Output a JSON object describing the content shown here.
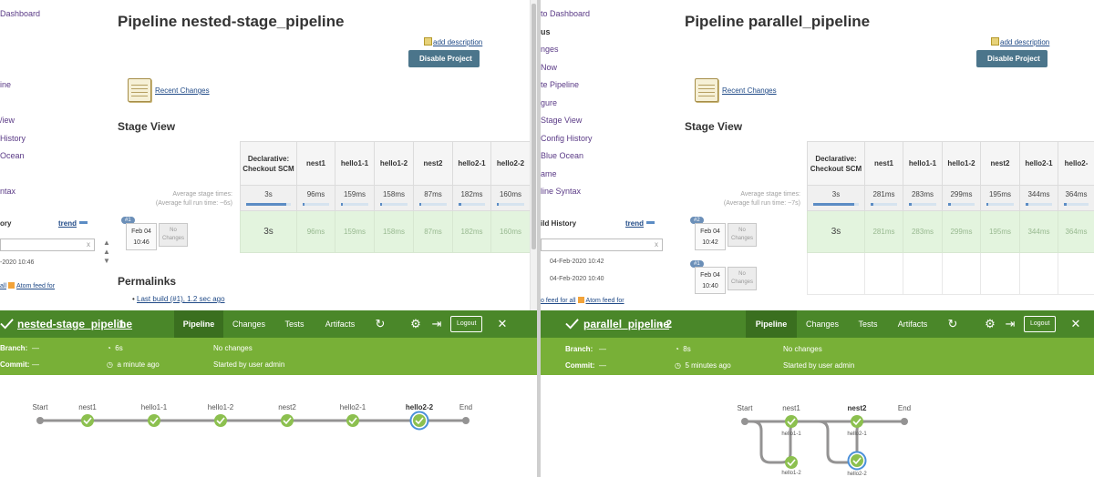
{
  "left": {
    "sidebar": [
      "Dashboard",
      "ine",
      "/iew",
      "History",
      "Ocean",
      "ntax"
    ],
    "title": "Pipeline nested-stage_pipeline",
    "add_description": "add description",
    "disable_button": "Disable Project",
    "recent_changes": "Recent Changes",
    "stage_view_title": "Stage View",
    "avg_label_1": "Average stage times:",
    "avg_label_2": "(Average full run time: ~6s)",
    "stages": [
      "Declarative: Checkout SCM",
      "nest1",
      "hello1-1",
      "hello1-2",
      "nest2",
      "hello2-1",
      "hello2-2"
    ],
    "avg_times": [
      "3s",
      "96ms",
      "159ms",
      "158ms",
      "87ms",
      "182ms",
      "160ms"
    ],
    "avg_fill": [
      0.9,
      0.06,
      0.08,
      0.08,
      0.05,
      0.09,
      0.08
    ],
    "runs": [
      {
        "num": "#1",
        "date": "Feb 04",
        "time": "10:46",
        "changes": "No Changes",
        "cells": [
          "3s",
          "96ms",
          "159ms",
          "158ms",
          "87ms",
          "182ms",
          "160ms"
        ]
      }
    ],
    "build_history_title": "ory",
    "trend": "trend",
    "search_clear": "x",
    "history_items": [
      "-2020 10:46"
    ],
    "feed_all": "all",
    "feed_atom": "Atom feed for",
    "permalinks_title": "Permalinks",
    "permalink_item": "Last build (#1), 1.2 sec ago",
    "blue_ocean": {
      "name": "nested-stage_pipeline",
      "run": "1",
      "tabs": [
        "Pipeline",
        "Changes",
        "Tests",
        "Artifacts"
      ],
      "logout": "Logout",
      "branch_label": "Branch:",
      "branch_value": "—",
      "commit_label": "Commit:",
      "commit_value": "—",
      "duration": "6s",
      "ago": "a minute ago",
      "changes": "No changes",
      "started_by": "Started by user admin",
      "graph_nodes": [
        "Start",
        "nest1",
        "hello1-1",
        "hello1-2",
        "nest2",
        "hello2-1",
        "hello2-2",
        "End"
      ]
    }
  },
  "right": {
    "sidebar": [
      "to Dashboard",
      "us",
      "nges",
      "Now",
      "te Pipeline",
      "gure",
      "Stage View",
      "Config History",
      "Blue Ocean",
      "ame",
      "line Syntax"
    ],
    "title": "Pipeline parallel_pipeline",
    "add_description": "add description",
    "disable_button": "Disable Project",
    "recent_changes": "Recent Changes",
    "stage_view_title": "Stage View",
    "avg_label_1": "Average stage times:",
    "avg_label_2": "(Average full run time: ~7s)",
    "stages": [
      "Declarative: Checkout SCM",
      "nest1",
      "hello1-1",
      "hello1-2",
      "nest2",
      "hello2-1",
      "hello2-"
    ],
    "avg_times": [
      "3s",
      "281ms",
      "283ms",
      "299ms",
      "195ms",
      "344ms",
      "364ms"
    ],
    "avg_fill": [
      0.9,
      0.09,
      0.09,
      0.1,
      0.07,
      0.11,
      0.12
    ],
    "runs": [
      {
        "num": "#2",
        "date": "Feb 04",
        "time": "10:42",
        "changes": "No Changes",
        "cells": [
          "3s",
          "281ms",
          "283ms",
          "299ms",
          "195ms",
          "344ms",
          "364ms"
        ]
      },
      {
        "num": "#1",
        "date": "Feb 04",
        "time": "10:40",
        "changes": "No Changes",
        "cells": [
          "",
          "",
          "",
          "",
          "",
          "",
          ""
        ]
      }
    ],
    "build_history_title": "ild History",
    "trend": "trend",
    "search_clear": "x",
    "history_items": [
      "04-Feb-2020 10:42",
      "04-Feb-2020 10:40"
    ],
    "feed_all": "o feed for all",
    "feed_atom": "Atom feed for",
    "blue_ocean": {
      "name": "parallel_pipeline",
      "run": "2",
      "tabs": [
        "Pipeline",
        "Changes",
        "Tests",
        "Artifacts"
      ],
      "logout": "Logout",
      "branch_label": "Branch:",
      "branch_value": "—",
      "commit_label": "Commit:",
      "commit_value": "—",
      "duration": "8s",
      "ago": "5 minutes ago",
      "changes": "No changes",
      "started_by": "Started by user admin",
      "graph_nodes": [
        "Start",
        "nest1",
        "nest2",
        "End"
      ],
      "graph_subnodes": [
        "hello1-1",
        "hello1-2",
        "hello2-1",
        "hello2-2"
      ]
    }
  },
  "colors": {
    "header_green": "#4a8729",
    "sub_green": "#78b037",
    "success": "#8cc04f",
    "selected_ring": "#4a90d9"
  }
}
